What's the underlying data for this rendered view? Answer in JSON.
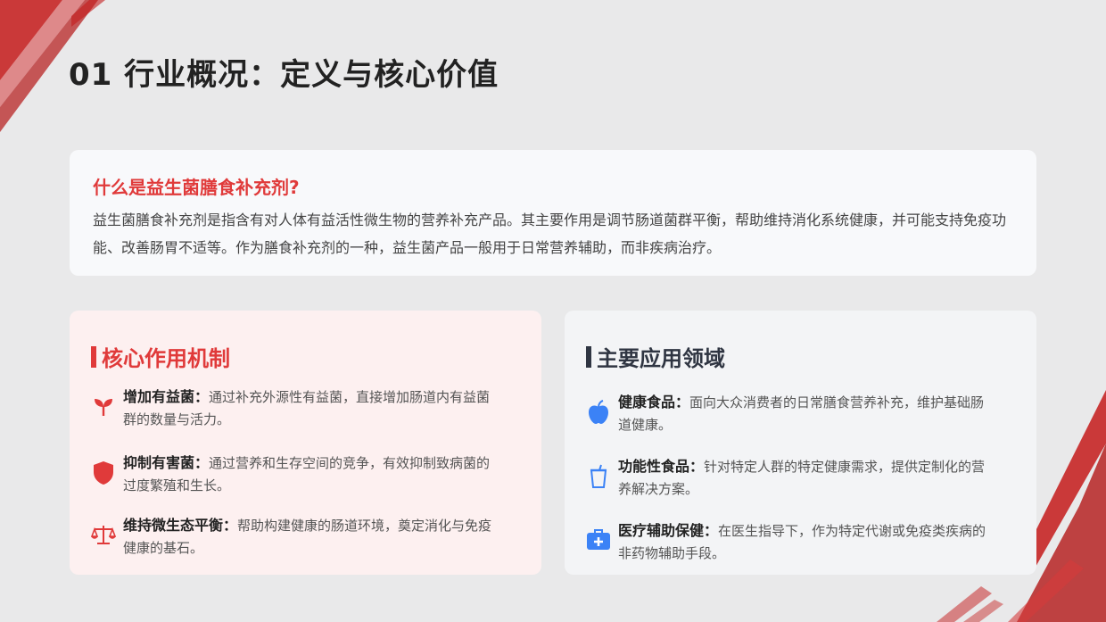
{
  "page": {
    "title": "01 行业概况：定义与核心价值"
  },
  "definition": {
    "question": "什么是益生菌膳食补充剂?",
    "text": "益生菌膳食补充剂是指含有对人体有益活性微生物的营养补充产品。其主要作用是调节肠道菌群平衡，帮助维持消化系统健康，并可能支持免疫功能、改善肠胃不适等。作为膳食补充剂的一种，益生菌产品一般用于日常营养辅助，而非疾病治疗。"
  },
  "mechanism": {
    "title": "核心作用机制",
    "items": [
      {
        "icon": "sprout-icon",
        "label": "增加有益菌：",
        "desc": "通过补充外源性有益菌，直接增加肠道内有益菌群的数量与活力。"
      },
      {
        "icon": "shield-icon",
        "label": "抑制有害菌：",
        "desc": "通过营养和生存空间的竞争，有效抑制致病菌的过度繁殖和生长。"
      },
      {
        "icon": "balance-scale-icon",
        "label": "维持微生态平衡：",
        "desc": "帮助构建健康的肠道环境，奠定消化与免疫健康的基石。"
      }
    ]
  },
  "applications": {
    "title": "主要应用领域",
    "items": [
      {
        "icon": "apple-icon",
        "label": "健康食品：",
        "desc": "面向大众消费者的日常膳食营养补充，维护基础肠道健康。"
      },
      {
        "icon": "cup-icon",
        "label": "功能性食品：",
        "desc": "针对特定人群的特定健康需求，提供定制化的营养解决方案。"
      },
      {
        "icon": "medical-kit-icon",
        "label": "医疗辅助保健：",
        "desc": "在医生指导下，作为特定代谢或免疫类疾病的非药物辅助手段。"
      }
    ]
  },
  "colors": {
    "accent": "#e03a3a",
    "dark": "#2f3542",
    "icon_blue": "#3b82f6",
    "decor_red": "#c41a1a"
  }
}
